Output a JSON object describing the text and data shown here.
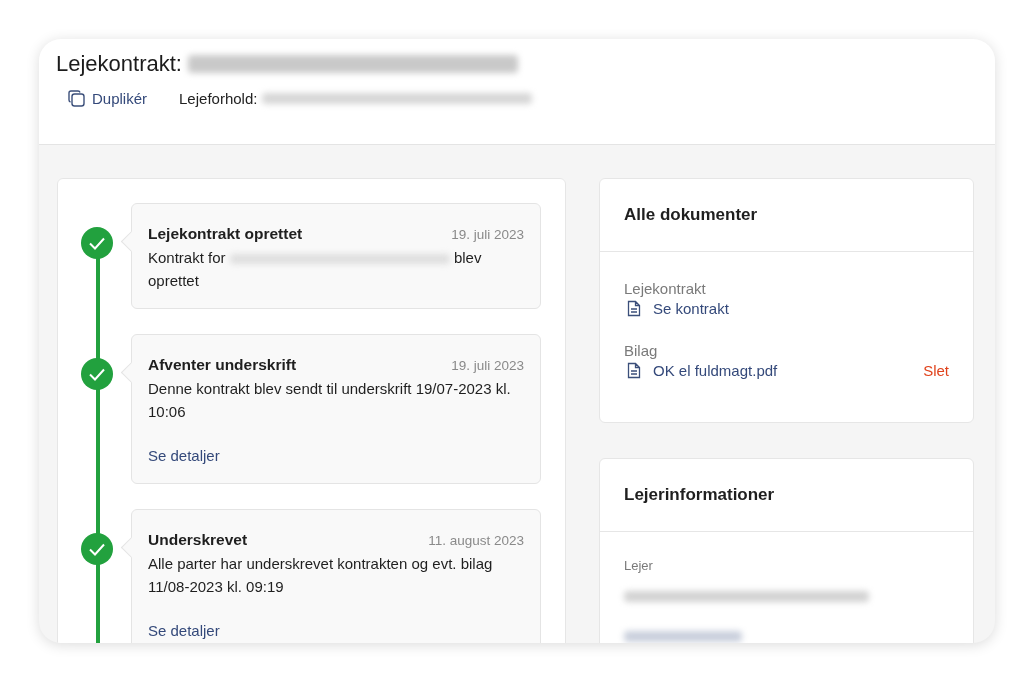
{
  "header": {
    "title": "Lejekontrakt:",
    "duplicate_button": "Duplikér",
    "tenancy_label": "Lejeforhold:"
  },
  "timeline": [
    {
      "title": "Lejekontrakt oprettet",
      "date": "19. juli 2023",
      "text_before": "Kontrakt for",
      "text_after": "blev oprettet",
      "done": true
    },
    {
      "title": "Afventer underskrift",
      "date": "19. juli 2023",
      "text": "Denne kontrakt blev sendt til underskrift 19/07-2023 kl. 10:06",
      "link": "Se detaljer",
      "done": true
    },
    {
      "title": "Underskrevet",
      "date": "11. august 2023",
      "text": "Alle parter har underskrevet kontrakten og evt. bilag 11/08-2023 kl. 09:19",
      "link": "Se detaljer",
      "done": true
    }
  ],
  "documents": {
    "title": "Alle dokumenter",
    "groups": [
      {
        "label": "Lejekontrakt",
        "file": "Se kontrakt"
      },
      {
        "label": "Bilag",
        "file": "OK el fuldmagt.pdf",
        "action": "Slet"
      }
    ]
  },
  "tenant_info": {
    "title": "Lejerinformationer",
    "label": "Lejer"
  }
}
